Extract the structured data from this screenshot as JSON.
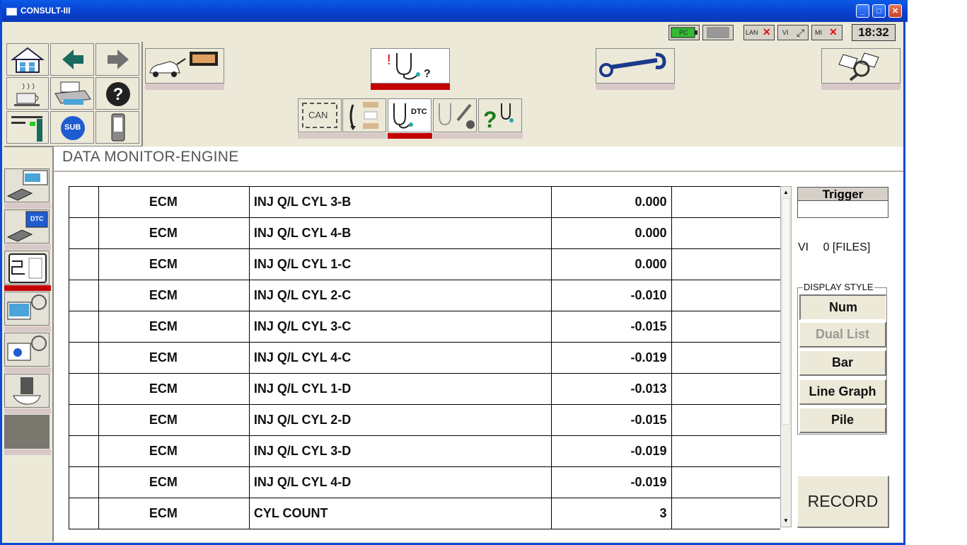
{
  "window": {
    "title": "CONSULT-III"
  },
  "status": {
    "pc_label": "PC",
    "lan_label": "LAN",
    "vi_label": "VI",
    "mi_label": "MI",
    "clock": "18:32"
  },
  "header": {
    "title": "DATA MONITOR-ENGINE"
  },
  "toolbar": {
    "can_label": "CAN",
    "dtc_label": "DTC",
    "sub_label": "SUB"
  },
  "left_panel": {
    "dtc_label": "DTC"
  },
  "table": {
    "rows": [
      {
        "system": "ECM",
        "item": "INJ Q/L CYL 3-B",
        "value": "0.000"
      },
      {
        "system": "ECM",
        "item": "INJ Q/L CYL 4-B",
        "value": "0.000"
      },
      {
        "system": "ECM",
        "item": "INJ Q/L CYL 1-C",
        "value": "0.000"
      },
      {
        "system": "ECM",
        "item": "INJ Q/L CYL 2-C",
        "value": "-0.010"
      },
      {
        "system": "ECM",
        "item": "INJ Q/L CYL 3-C",
        "value": "-0.015"
      },
      {
        "system": "ECM",
        "item": "INJ Q/L CYL 4-C",
        "value": "-0.019"
      },
      {
        "system": "ECM",
        "item": "INJ Q/L CYL 1-D",
        "value": "-0.013"
      },
      {
        "system": "ECM",
        "item": "INJ Q/L CYL 2-D",
        "value": "-0.015"
      },
      {
        "system": "ECM",
        "item": "INJ Q/L CYL 3-D",
        "value": "-0.019"
      },
      {
        "system": "ECM",
        "item": "INJ Q/L CYL 4-D",
        "value": "-0.019"
      },
      {
        "system": "ECM",
        "item": "CYL COUNT",
        "value": "3"
      }
    ]
  },
  "side": {
    "trigger_label": "Trigger",
    "vi_label": "VI",
    "files_label": "0 [FILES]",
    "display_style_label": "DISPLAY STYLE",
    "display_buttons": [
      {
        "label": "Num",
        "state": "selected"
      },
      {
        "label": "Dual List",
        "state": "disabled"
      },
      {
        "label": "Bar",
        "state": "normal"
      },
      {
        "label": "Line Graph",
        "state": "normal"
      },
      {
        "label": "Pile",
        "state": "normal"
      }
    ],
    "record_label": "RECORD"
  },
  "colors": {
    "title_bar": "#0a48d8",
    "active_red": "#c40000",
    "panel": "#ece9d8"
  }
}
